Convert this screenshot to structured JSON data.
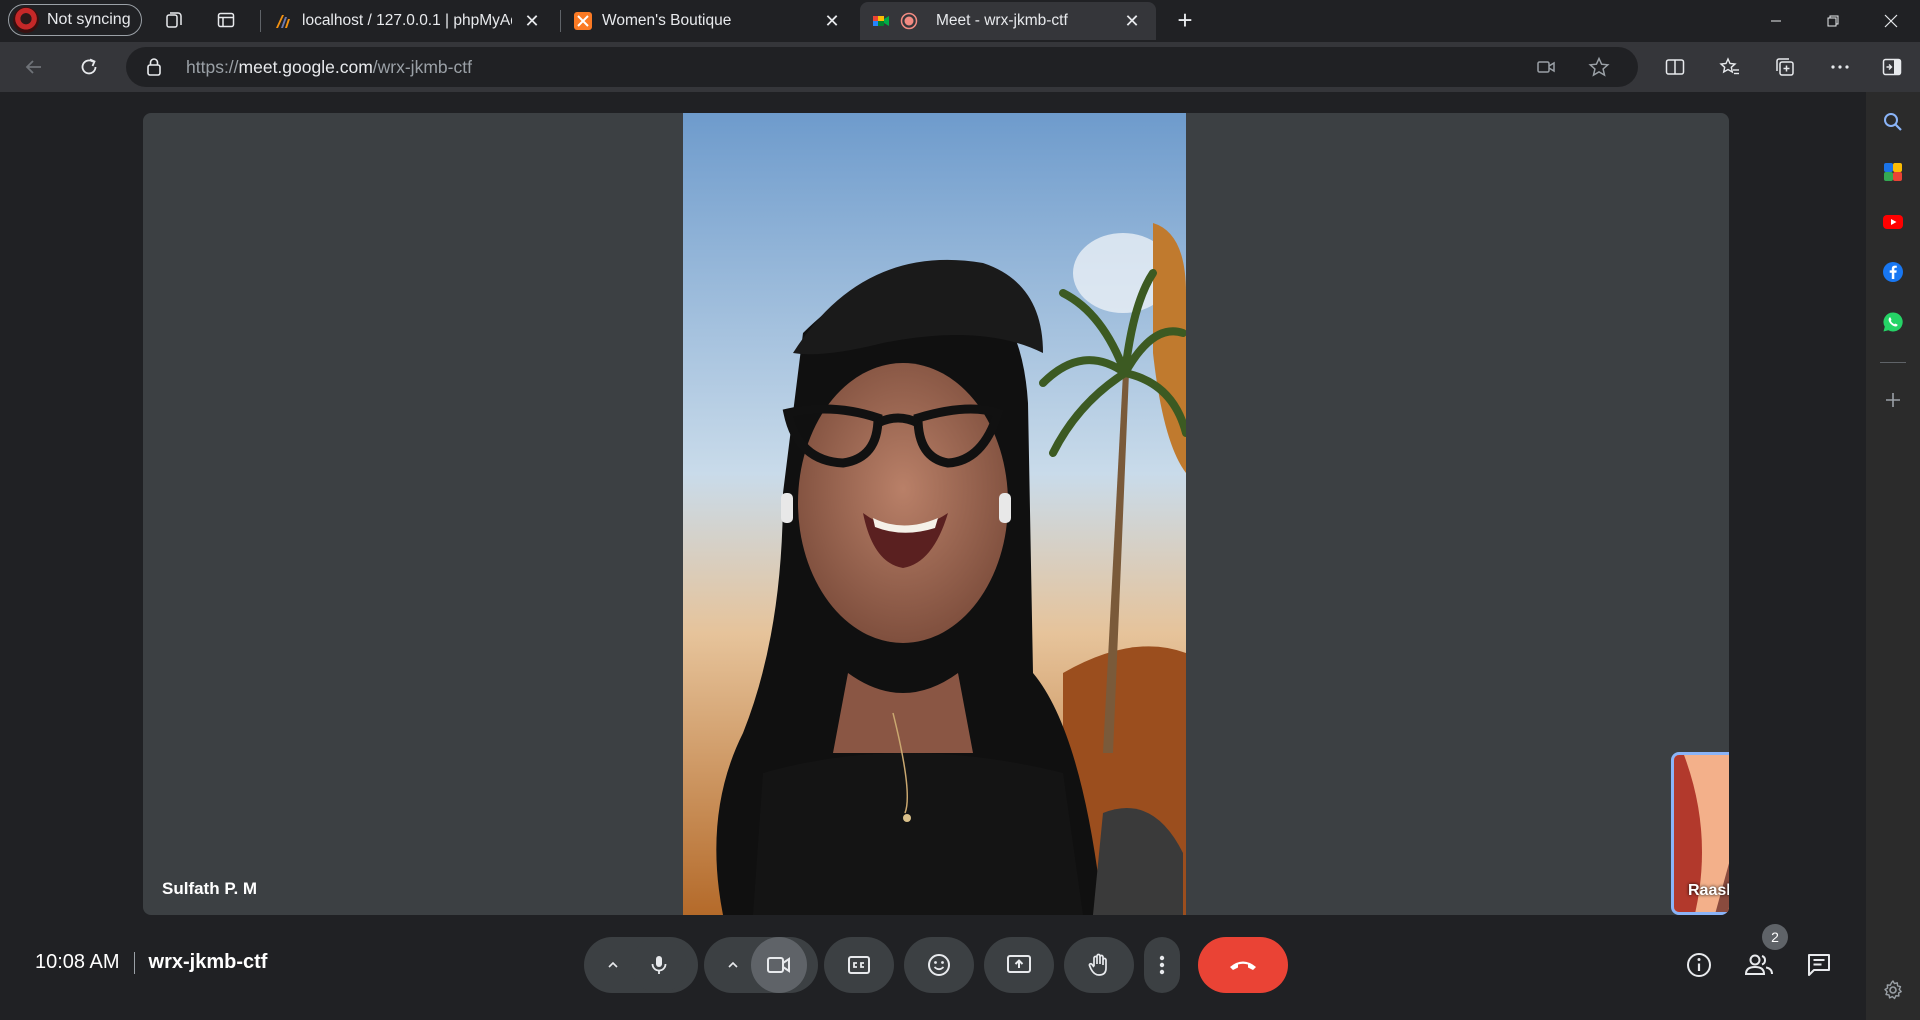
{
  "browser": {
    "profile_label": "Not syncing",
    "tabs": [
      {
        "title": "localhost / 127.0.0.1 | phpMyAdmin",
        "favicon": "phpmyadmin-icon"
      },
      {
        "title": "Women's Boutique",
        "favicon": "xampp-icon"
      },
      {
        "title": "Meet - wrx-jkmb-ctf",
        "favicon": "google-meet-icon",
        "active": true,
        "recording": true
      }
    ],
    "url_prefix": "https://",
    "url_host": "meet.google.com",
    "url_path": "/wrx-jkmb-ctf"
  },
  "meet": {
    "main_participant": "Sulfath P. M",
    "self_participant": "Raashid V Z",
    "time": "10:08 AM",
    "meeting_code": "wrx-jkmb-ctf",
    "participant_count": "2",
    "colors": {
      "end_call": "#ea4335",
      "accent": "#1a73e8",
      "self_border": "#8ab4f8"
    }
  },
  "sidebar": {
    "icons": [
      "search-icon",
      "copilot-icon",
      "youtube-icon",
      "facebook-icon",
      "whatsapp-icon",
      "add-icon",
      "settings-icon"
    ]
  }
}
